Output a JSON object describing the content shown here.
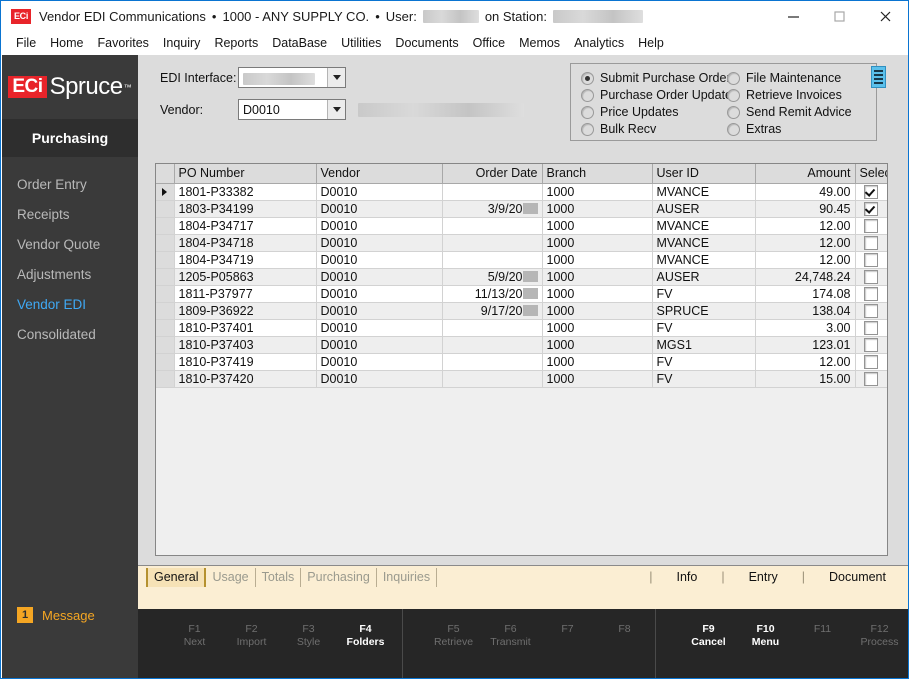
{
  "window": {
    "app_badge": "ECi",
    "title": "Vendor EDI Communications",
    "separator": "•",
    "company": "1000 - ANY SUPPLY CO.",
    "user_label": "User:",
    "station_label": "on Station:",
    "minimize": "–",
    "maximize": "□",
    "close": "✕"
  },
  "menubar": {
    "items": [
      {
        "label": "File"
      },
      {
        "label": "Home"
      },
      {
        "label": "Favorites"
      },
      {
        "label": "Inquiry"
      },
      {
        "label": "Reports"
      },
      {
        "label": "DataBase"
      },
      {
        "label": "Utilities"
      },
      {
        "label": "Documents"
      },
      {
        "label": "Office"
      },
      {
        "label": "Memos"
      },
      {
        "label": "Analytics"
      },
      {
        "label": "Help"
      }
    ]
  },
  "sidebar": {
    "logo_eci": "ECi",
    "logo_product": "Spruce",
    "logo_tm": "™",
    "module": "Purchasing",
    "items": [
      {
        "label": "Order Entry",
        "active": false
      },
      {
        "label": "Receipts",
        "active": false
      },
      {
        "label": "Vendor Quote",
        "active": false
      },
      {
        "label": "Adjustments",
        "active": false
      },
      {
        "label": "Vendor EDI",
        "active": true
      },
      {
        "label": "Consolidated",
        "active": false
      }
    ],
    "message": {
      "count": "1",
      "label": "Message"
    },
    "accent_color": "#3fa9f5",
    "message_color": "#f5a623"
  },
  "form": {
    "edi_interface_label": "EDI Interface:",
    "edi_interface_value": "",
    "vendor_label": "Vendor:",
    "vendor_value": "D0010",
    "vendor_name_value": ""
  },
  "actions": {
    "column1": [
      {
        "label": "Submit Purchase Orders",
        "selected": true
      },
      {
        "label": "Purchase Order Update",
        "selected": false
      },
      {
        "label": "Price Updates",
        "selected": false
      },
      {
        "label": "Bulk Recv",
        "selected": false
      }
    ],
    "column2": [
      {
        "label": "File Maintenance",
        "selected": false
      },
      {
        "label": "Retrieve Invoices",
        "selected": false
      },
      {
        "label": "Send Remit Advice",
        "selected": false
      },
      {
        "label": "Extras",
        "selected": false
      }
    ]
  },
  "grid": {
    "columns": [
      {
        "label": "PO Number",
        "align": "left"
      },
      {
        "label": "Vendor",
        "align": "left"
      },
      {
        "label": "Order Date",
        "align": "right"
      },
      {
        "label": "Branch",
        "align": "left"
      },
      {
        "label": "User ID",
        "align": "left"
      },
      {
        "label": "Amount",
        "align": "right"
      },
      {
        "label": "Select",
        "align": "center"
      }
    ],
    "rows": [
      {
        "po": "1801-P33382",
        "vendor": "D0010",
        "date": "",
        "date_redacted": false,
        "branch": "1000",
        "user": "MVANCE",
        "amount": "49.00",
        "selected": true,
        "current": true
      },
      {
        "po": "1803-P34199",
        "vendor": "D0010",
        "date": "3/9/20",
        "date_redacted": true,
        "branch": "1000",
        "user": "AUSER",
        "amount": "90.45",
        "selected": true,
        "current": false
      },
      {
        "po": "1804-P34717",
        "vendor": "D0010",
        "date": "",
        "date_redacted": false,
        "branch": "1000",
        "user": "MVANCE",
        "amount": "12.00",
        "selected": false,
        "current": false
      },
      {
        "po": "1804-P34718",
        "vendor": "D0010",
        "date": "",
        "date_redacted": false,
        "branch": "1000",
        "user": "MVANCE",
        "amount": "12.00",
        "selected": false,
        "current": false
      },
      {
        "po": "1804-P34719",
        "vendor": "D0010",
        "date": "",
        "date_redacted": false,
        "branch": "1000",
        "user": "MVANCE",
        "amount": "12.00",
        "selected": false,
        "current": false
      },
      {
        "po": "1205-P05863",
        "vendor": "D0010",
        "date": "5/9/20",
        "date_redacted": true,
        "branch": "1000",
        "user": "AUSER",
        "amount": "24,748.24",
        "selected": false,
        "current": false
      },
      {
        "po": "1811-P37977",
        "vendor": "D0010",
        "date": "11/13/20",
        "date_redacted": true,
        "branch": "1000",
        "user": "FV",
        "amount": "174.08",
        "selected": false,
        "current": false
      },
      {
        "po": "1809-P36922",
        "vendor": "D0010",
        "date": "9/17/20",
        "date_redacted": true,
        "branch": "1000",
        "user": "SPRUCE",
        "amount": "138.04",
        "selected": false,
        "current": false
      },
      {
        "po": "1810-P37401",
        "vendor": "D0010",
        "date": "",
        "date_redacted": false,
        "branch": "1000",
        "user": "FV",
        "amount": "3.00",
        "selected": false,
        "current": false
      },
      {
        "po": "1810-P37403",
        "vendor": "D0010",
        "date": "",
        "date_redacted": false,
        "branch": "1000",
        "user": "MGS1",
        "amount": "123.01",
        "selected": false,
        "current": false
      },
      {
        "po": "1810-P37419",
        "vendor": "D0010",
        "date": "",
        "date_redacted": false,
        "branch": "1000",
        "user": "FV",
        "amount": "12.00",
        "selected": false,
        "current": false
      },
      {
        "po": "1810-P37420",
        "vendor": "D0010",
        "date": "",
        "date_redacted": false,
        "branch": "1000",
        "user": "FV",
        "amount": "15.00",
        "selected": false,
        "current": false
      }
    ]
  },
  "tabbar": {
    "tabs": [
      {
        "label": "General",
        "active": true
      },
      {
        "label": "Usage",
        "active": false
      },
      {
        "label": "Totals",
        "active": false
      },
      {
        "label": "Purchasing",
        "active": false
      },
      {
        "label": "Inquiries",
        "active": false
      }
    ],
    "right_actions": [
      {
        "label": "Info"
      },
      {
        "label": "Entry"
      },
      {
        "label": "Document"
      }
    ],
    "divider": "|"
  },
  "fkeys": {
    "group1": [
      {
        "key": "F1",
        "label": "Next",
        "enabled": false
      },
      {
        "key": "F2",
        "label": "Import",
        "enabled": false
      },
      {
        "key": "F3",
        "label": "Style",
        "enabled": false
      },
      {
        "key": "F4",
        "label": "Folders",
        "enabled": true
      }
    ],
    "group2": [
      {
        "key": "F5",
        "label": "Retrieve",
        "enabled": false
      },
      {
        "key": "F6",
        "label": "Transmit",
        "enabled": false
      },
      {
        "key": "F7",
        "label": "",
        "enabled": false
      },
      {
        "key": "F8",
        "label": "",
        "enabled": false
      }
    ],
    "group3": [
      {
        "key": "F9",
        "label": "Cancel",
        "enabled": true
      },
      {
        "key": "F10",
        "label": "Menu",
        "enabled": true
      },
      {
        "key": "F11",
        "label": "",
        "enabled": false
      },
      {
        "key": "F12",
        "label": "Process",
        "enabled": false
      }
    ]
  }
}
